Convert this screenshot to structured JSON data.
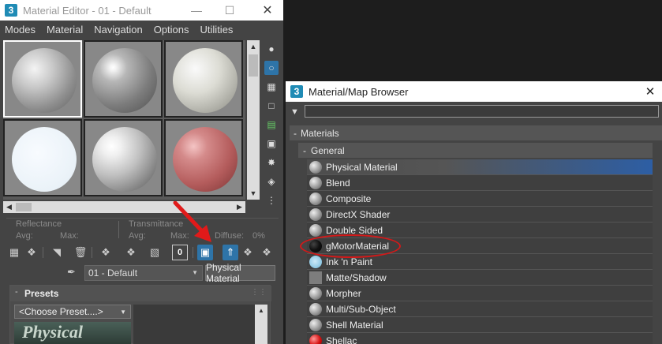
{
  "material_editor": {
    "title": "Material Editor - 01 - Default",
    "app_icon": "3",
    "menu": [
      "Modes",
      "Material",
      "Navigation",
      "Options",
      "Utilities"
    ],
    "slots": [
      {
        "sphere": "grey"
      },
      {
        "sphere": "shiny"
      },
      {
        "sphere": "white"
      },
      {
        "sphere": "pale"
      },
      {
        "sphere": "chrome"
      },
      {
        "sphere": "red"
      }
    ],
    "active_slot": 1,
    "info": {
      "reflectance": "Reflectance",
      "avg1": "Avg:",
      "max1": "Max:",
      "transmittance": "Transmittance",
      "avg2": "Avg:",
      "max2": "Max:",
      "diffuse": "Diffuse:",
      "diffuse_value": "0%"
    },
    "toolbar_icons": [
      "get-material-icon",
      "put-to-scene-icon",
      "assign-to-selection-icon",
      "reset-icon",
      "make-copy-icon",
      "make-unique-icon",
      "put-to-library-icon",
      "material-id-icon",
      "show-shaded-material-icon",
      "show-end-result-icon",
      "go-to-parent-icon",
      "go-forward-sibling-icon"
    ],
    "toolbar_glyph_id": "0",
    "material_name": "01 - Default",
    "material_type": "Physical Material",
    "presets": {
      "heading": "Presets",
      "collapse": "-",
      "choose_preset": "<Choose Preset....>",
      "thumb_text": "Physical"
    }
  },
  "browser": {
    "title": "Material/Map Browser",
    "app_icon": "3",
    "search_placeholder": "",
    "category": "Materials",
    "category_toggle": "-",
    "subcategory": "General",
    "subcategory_toggle": "-",
    "materials": [
      {
        "label": "Physical Material",
        "icon": "grey"
      },
      {
        "label": "Blend",
        "icon": "grey"
      },
      {
        "label": "Composite",
        "icon": "grey"
      },
      {
        "label": "DirectX Shader",
        "icon": "grey"
      },
      {
        "label": "Double Sided",
        "icon": "grey"
      },
      {
        "label": "gMotorMaterial",
        "icon": "black"
      },
      {
        "label": "Ink 'n Paint",
        "icon": "light"
      },
      {
        "label": "Matte/Shadow",
        "icon": "flat"
      },
      {
        "label": "Morpher",
        "icon": "grey"
      },
      {
        "label": "Multi/Sub-Object",
        "icon": "grey"
      },
      {
        "label": "Shell Material",
        "icon": "grey"
      },
      {
        "label": "Shellac",
        "icon": "red"
      }
    ],
    "selected_index": 0
  },
  "annotations": {
    "arrow_color": "#e11a1a",
    "circle_color": "#d21919",
    "circled_item": "gMotorMaterial"
  }
}
